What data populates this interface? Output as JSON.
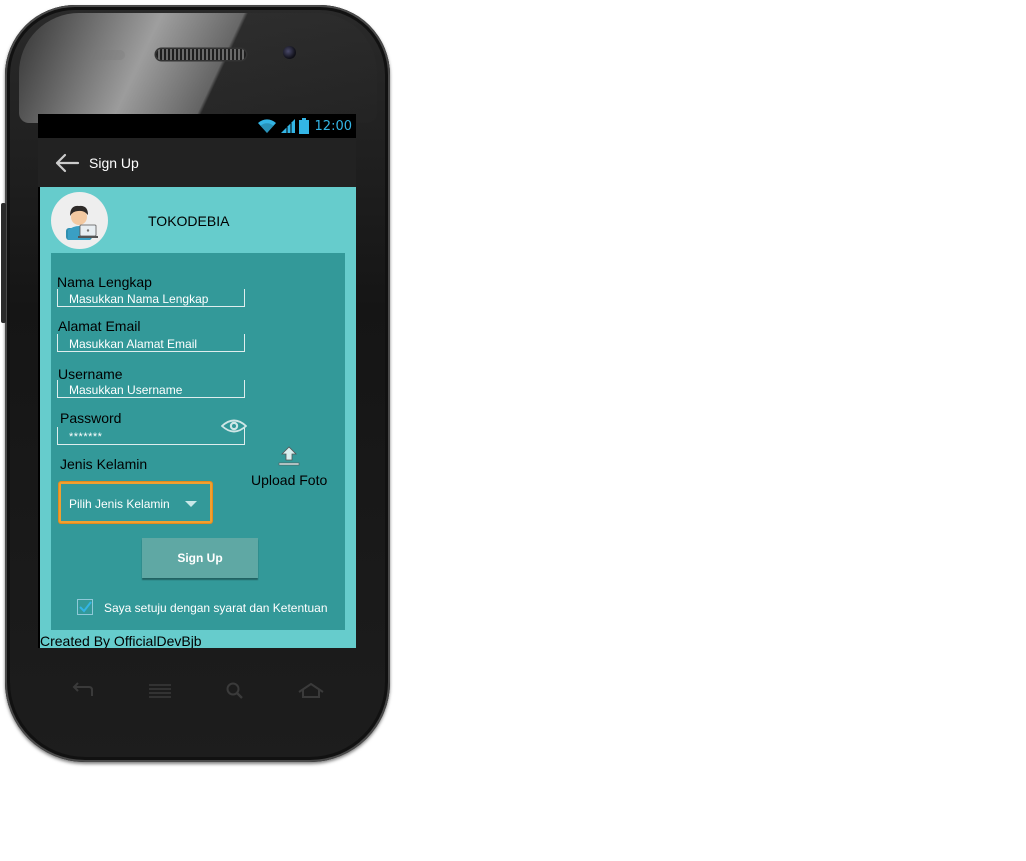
{
  "status_bar": {
    "time": "12:00",
    "icons": [
      "wifi-icon",
      "signal-icon",
      "battery-icon"
    ],
    "accent_color": "#33b5e5"
  },
  "action_bar": {
    "title": "Sign Up",
    "back_icon": "arrow-left-icon"
  },
  "header": {
    "avatar_icon": "user-laptop-avatar-icon",
    "brand": "TOKODEBIA"
  },
  "form": {
    "full_name": {
      "label": "Nama Lengkap",
      "placeholder": "Masukkan Nama Lengkap"
    },
    "email": {
      "label": "Alamat Email",
      "placeholder": "Masukkan Alamat Email"
    },
    "username": {
      "label": "Username",
      "placeholder": "Masukkan Username"
    },
    "password": {
      "label": "Password",
      "value": "*******",
      "toggle_icon": "eye-icon"
    },
    "gender": {
      "label": "Jenis Kelamin",
      "selected": "Pilih Jenis Kelamin"
    },
    "upload": {
      "label": "Upload Foto",
      "icon": "upload-icon"
    },
    "submit_label": "Sign Up",
    "agree": {
      "label": "Saya setuju dengan syarat dan Ketentuan",
      "checked": true
    }
  },
  "footer": {
    "credit": "Created By OfficialDevBjb"
  },
  "hardware_keys": [
    "back-key-icon",
    "menu-key-icon",
    "search-key-icon",
    "home-key-icon"
  ],
  "colors": {
    "background": "#66cccc",
    "form_panel": "#339999",
    "action_bar": "#222222",
    "select_highlight": "#f0a030",
    "button": "#5fa8a4"
  }
}
